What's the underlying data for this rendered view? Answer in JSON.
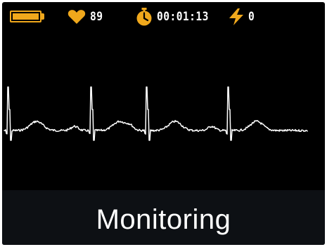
{
  "status": {
    "battery": {
      "icon": "battery-icon",
      "level": 1.0
    },
    "heart_rate": {
      "icon": "heart-icon",
      "value": "89"
    },
    "timer": {
      "icon": "stopwatch-icon",
      "value": "00:01:13"
    },
    "shocks": {
      "icon": "lightning-icon",
      "value": "0"
    }
  },
  "ecg": {
    "trace_color": "#ffffff",
    "beats": 4
  },
  "footer": {
    "mode_label": "Monitoring"
  },
  "colors": {
    "accent": "#f0a81c",
    "background": "#000000",
    "footer_bg": "#0d1014"
  }
}
